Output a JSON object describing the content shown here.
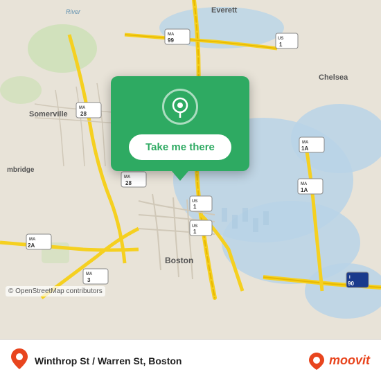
{
  "map": {
    "attribution": "© OpenStreetMap contributors",
    "popup": {
      "button_label": "Take me there"
    }
  },
  "bottom_bar": {
    "location_name": "Winthrop St / Warren St, Boston",
    "moovit_label": "moovit"
  }
}
